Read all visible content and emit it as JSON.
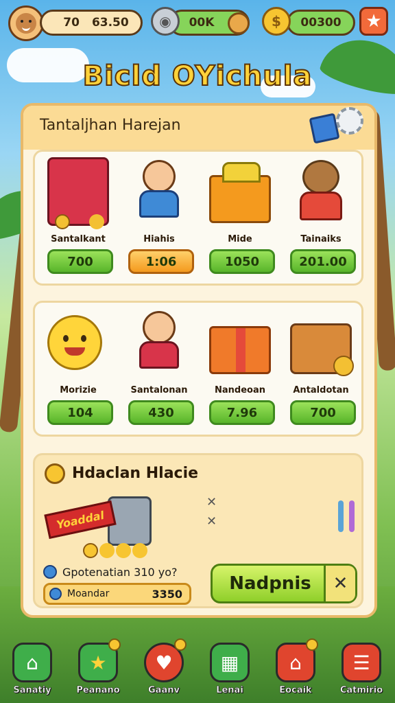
{
  "topbar": {
    "level_prefix": "70",
    "level_value": "63.50",
    "silver_value": "00K",
    "gold_value": "00300"
  },
  "title": "Bicld OYichula",
  "panel": {
    "title": "Tantaljhan Harejan",
    "row1": [
      {
        "name": "Santalkant",
        "price": "700",
        "style": "green",
        "icon": "red-chest-icon"
      },
      {
        "name": "Hiahis",
        "price": "1:06",
        "style": "orange",
        "icon": "character-icon"
      },
      {
        "name": "Mide",
        "price": "1050",
        "style": "green",
        "icon": "treasure-box-icon"
      },
      {
        "name": "Tainaiks",
        "price": "201.00",
        "style": "green",
        "icon": "bear-icon"
      }
    ],
    "row2": [
      {
        "name": "Morizie",
        "price": "104",
        "style": "green",
        "icon": "sun-icon"
      },
      {
        "name": "Santalonan",
        "price": "430",
        "style": "green",
        "icon": "boy-icon"
      },
      {
        "name": "Nandeoan",
        "price": "7.96",
        "style": "green",
        "icon": "gift-box-icon"
      },
      {
        "name": "Antaldotan",
        "price": "700",
        "style": "green",
        "icon": "crate-icon"
      }
    ]
  },
  "promo": {
    "title": "Hdaclan Hlacie",
    "banner": "Yoaddal",
    "line1": "Gpotenatian 310 yo?",
    "line2_label": "Moandar",
    "line2_value": "3350",
    "button_label": "Nadpnis",
    "close_glyph": "✕"
  },
  "nav": [
    {
      "label": "Sanatiy",
      "icon": "home-icon",
      "color": "#3fae4a",
      "glyph": "⌂"
    },
    {
      "label": "Peanano",
      "icon": "star-icon",
      "color": "#3fae4a",
      "glyph": "★"
    },
    {
      "label": "Gaanv",
      "icon": "heart-icon",
      "color": "#e0452e",
      "glyph": "♥"
    },
    {
      "label": "Lenai",
      "icon": "grid-icon",
      "color": "#3fae4a",
      "glyph": "▦"
    },
    {
      "label": "Eocaik",
      "icon": "shop-icon",
      "color": "#e0452e",
      "glyph": "⌂"
    },
    {
      "label": "Catmirio",
      "icon": "menu-icon",
      "color": "#e0452e",
      "glyph": "☰"
    }
  ]
}
